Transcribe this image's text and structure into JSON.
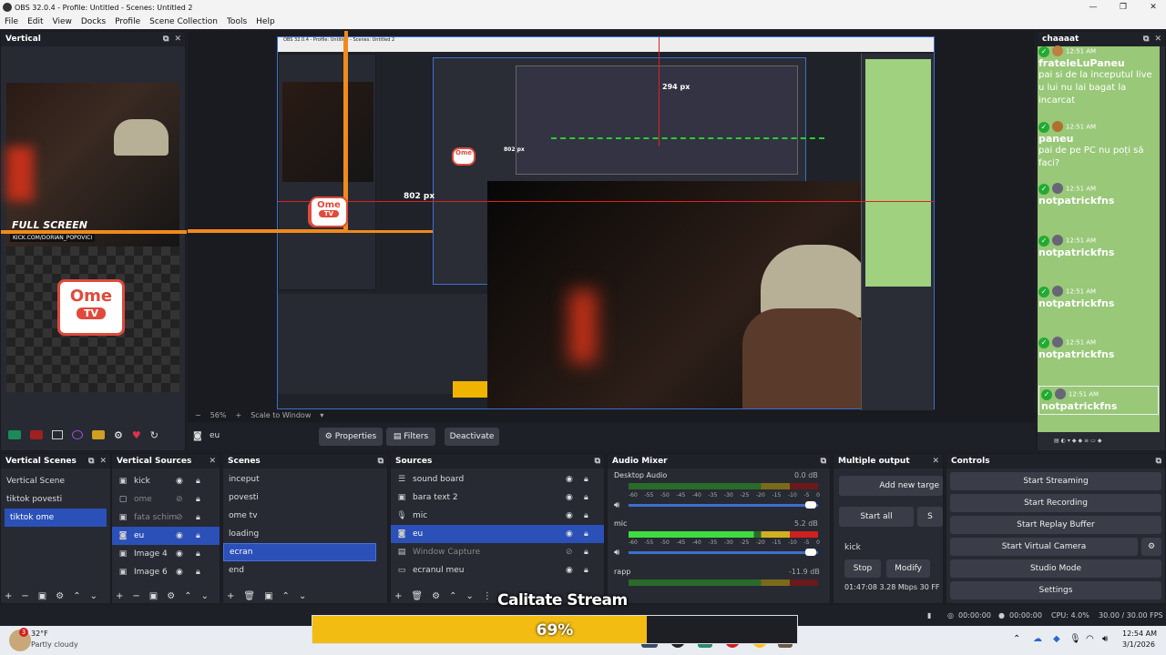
{
  "window": {
    "title": "OBS 32.0.4 - Profile: Untitled - Scenes: Untitled 2",
    "minimize": "—",
    "maximize": "❐",
    "close": "✕"
  },
  "menu": [
    "File",
    "Edit",
    "View",
    "Docks",
    "Profile",
    "Scene Collection",
    "Tools",
    "Help"
  ],
  "vertical_dock": {
    "title": "Vertical",
    "full_screen_text": "FULL SCREEN",
    "kick_handle": "KICK.COM/DORIAN_POPOVICI",
    "ome_line1": "Ome",
    "ome_line2": "TV"
  },
  "preview": {
    "measure_label_1": "802 px",
    "measure_label_2": "294 px",
    "measure_label_3": "802 px",
    "zoom": "56%",
    "scale": "Scale to Window",
    "minus": "−",
    "plus": "+",
    "inner_nested_title": "OBS 32.0.4 - Profile: Untitled - Scenes: Untitled 2"
  },
  "source_toolbar": {
    "current_source": "eu",
    "properties": "Properties",
    "filters": "Filters",
    "deactivate": "Deactivate"
  },
  "vertical_scenes": {
    "title": "Vertical Scenes",
    "items": [
      "Vertical Scene",
      "tiktok povesti",
      "tiktok ome"
    ],
    "selected": 2
  },
  "vertical_sources": {
    "title": "Vertical Sources",
    "items": [
      "kick",
      "ome",
      "fata schim",
      "eu",
      "Image 4",
      "Image 6"
    ],
    "selected": 3
  },
  "scenes": {
    "title": "Scenes",
    "items": [
      "inceput",
      "povesti",
      "ome tv",
      "loading",
      "ecran",
      "end"
    ],
    "selected": 4
  },
  "sources": {
    "title": "Sources",
    "items": [
      "sound board",
      "bara text 2",
      "mic",
      "eu",
      "Window Capture",
      "ecranul meu"
    ],
    "selected": 3
  },
  "audio_mixer": {
    "title": "Audio Mixer",
    "channels": [
      {
        "name": "Desktop Audio",
        "db": "0.0 dB"
      },
      {
        "name": "mic",
        "db": "5.2 dB"
      },
      {
        "name": "rapp",
        "db": "-11.9 dB"
      }
    ],
    "scale": [
      "-60",
      "-55",
      "-50",
      "-45",
      "-40",
      "-35",
      "-30",
      "-25",
      "-20",
      "-15",
      "-10",
      "-5",
      "0"
    ]
  },
  "multiple_output": {
    "title": "Multiple output",
    "add_target": "Add new targe",
    "start_all": "Start all",
    "start_all_2": "S",
    "target": "kick",
    "stop": "Stop",
    "modify": "Modify",
    "stats": "01:47:08  3.28 Mbps  30 FF"
  },
  "controls": {
    "title": "Controls",
    "buttons": [
      "Start Streaming",
      "Start Recording",
      "Start Replay Buffer",
      "Start Virtual Camera",
      "Studio Mode",
      "Settings"
    ]
  },
  "chat": {
    "title": "chaaaat",
    "messages": [
      {
        "time": "12:51 AM",
        "user": "frateleLuPaneu",
        "text": "pai si de la inceputul live u lui nu lai bagat la incarcat"
      },
      {
        "time": "12:51 AM",
        "user": "paneu",
        "text": "pai de pe PC nu poți să faci?"
      },
      {
        "time": "12:51 AM",
        "user": "notpatrickfns",
        "text": ""
      },
      {
        "time": "12:51 AM",
        "user": "notpatrickfns",
        "text": ""
      },
      {
        "time": "12:51 AM",
        "user": "notpatrickfns",
        "text": ""
      },
      {
        "time": "12:51 AM",
        "user": "notpatrickfns",
        "text": ""
      },
      {
        "time": "12:51 AM",
        "user": "notpatrickfns",
        "text": ""
      }
    ]
  },
  "overlay": {
    "label": "Calitate Stream",
    "percent": "69%",
    "progress": 0.69
  },
  "status_bar": {
    "time1": "00:00:00",
    "time2": "00:00:00",
    "cpu": "CPU: 4.0%",
    "fps": "30.00 / 30.00 FPS"
  },
  "taskbar": {
    "weather_temp": "32°F",
    "weather_desc": "Partly cloudy",
    "weather_badge": "3",
    "clock_time": "12:54 AM",
    "clock_date": "3/1/2026"
  }
}
